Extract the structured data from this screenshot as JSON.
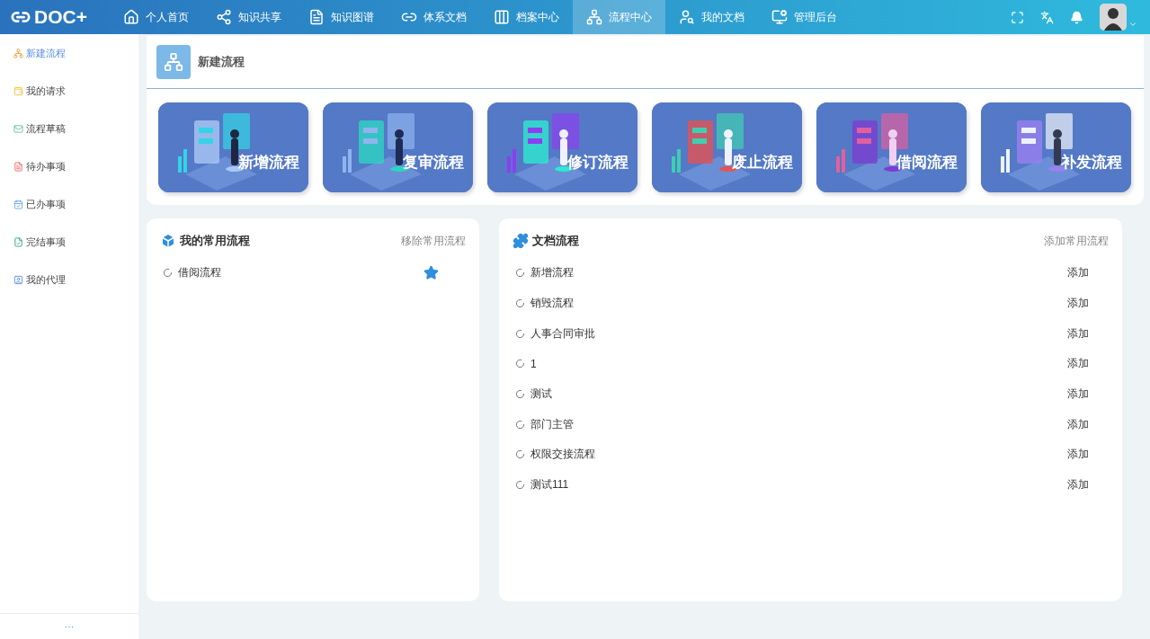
{
  "app": {
    "logo": "DOC+"
  },
  "nav": [
    {
      "label": "个人首页",
      "selected": false
    },
    {
      "label": "知识共享",
      "selected": false
    },
    {
      "label": "知识图谱",
      "selected": false
    },
    {
      "label": "体系文档",
      "selected": false
    },
    {
      "label": "档案中心",
      "selected": false
    },
    {
      "label": "流程中心",
      "selected": true
    },
    {
      "label": "我的文档",
      "selected": false
    },
    {
      "label": "管理后台",
      "selected": false
    }
  ],
  "sidebar": {
    "items": [
      {
        "label": "新建流程",
        "selected": true
      },
      {
        "label": "我的请求",
        "selected": false
      },
      {
        "label": "流程草稿",
        "selected": false
      },
      {
        "label": "待办事项",
        "selected": false
      },
      {
        "label": "已办事项",
        "selected": false
      },
      {
        "label": "完结事项",
        "selected": false
      },
      {
        "label": "我的代理",
        "selected": false
      }
    ],
    "footer": "···"
  },
  "header": {
    "title": "新建流程"
  },
  "flows": [
    {
      "label": "新增流程"
    },
    {
      "label": "复审流程"
    },
    {
      "label": "修订流程"
    },
    {
      "label": "废止流程"
    },
    {
      "label": "借阅流程"
    },
    {
      "label": "补发流程"
    }
  ],
  "favorites": {
    "title": "我的常用流程",
    "action": "移除常用流程",
    "items": [
      {
        "label": "借阅流程",
        "starred": true
      }
    ]
  },
  "documents": {
    "title": "文档流程",
    "action": "添加常用流程",
    "items": [
      {
        "label": "新增流程",
        "action": "添加"
      },
      {
        "label": "销毁流程",
        "action": "添加"
      },
      {
        "label": "人事合同审批",
        "action": "添加"
      },
      {
        "label": "1",
        "action": "添加"
      },
      {
        "label": "测试",
        "action": "添加"
      },
      {
        "label": "部门主管",
        "action": "添加"
      },
      {
        "label": "权限交接流程",
        "action": "添加"
      },
      {
        "label": "测试111",
        "action": "添加"
      }
    ]
  }
}
